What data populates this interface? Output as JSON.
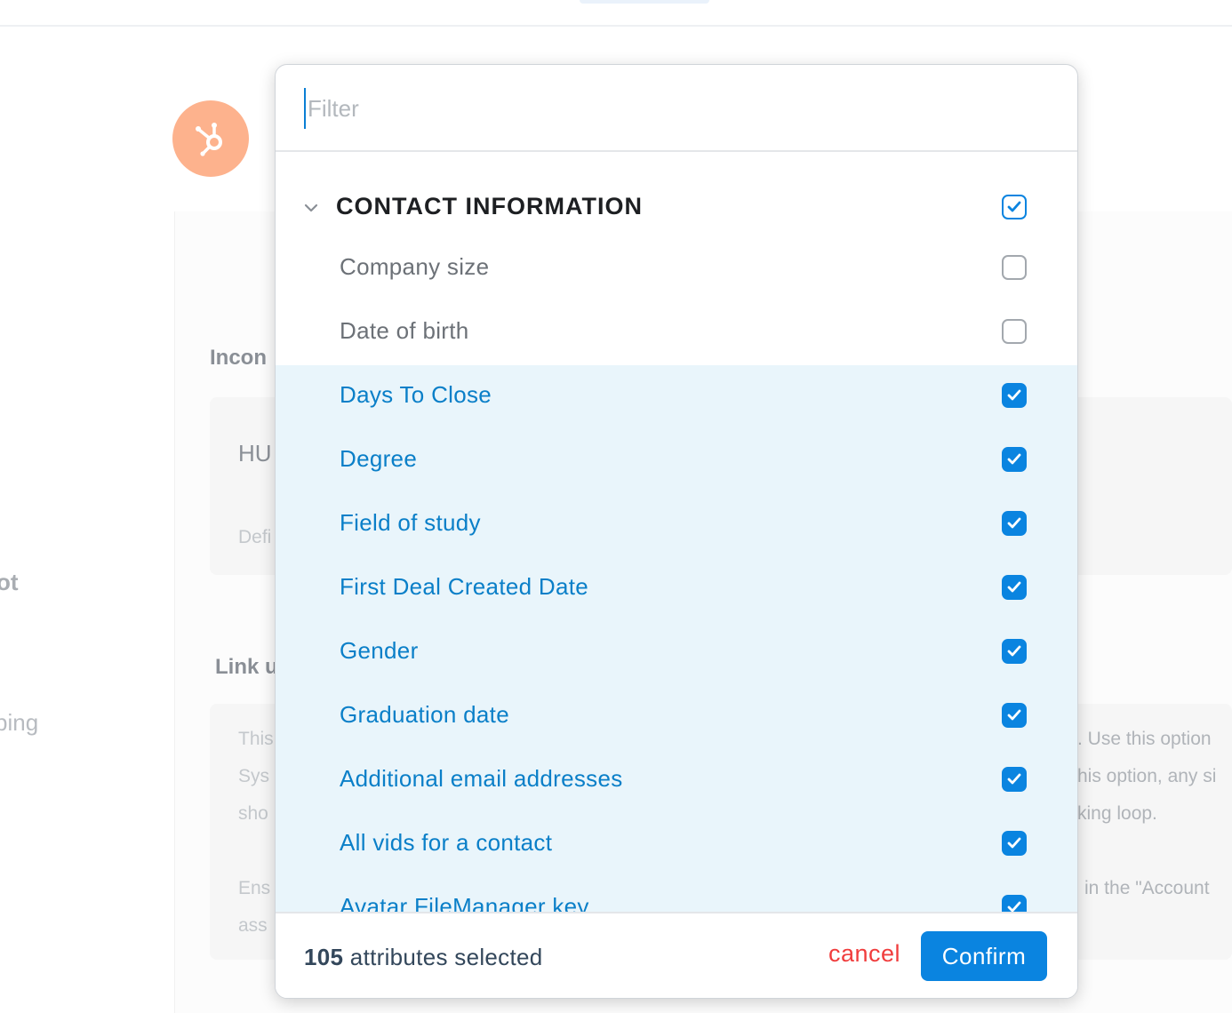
{
  "background": {
    "heading_income": "Incon",
    "box1_title": "HU",
    "box1_sub": "Defi",
    "heading_link": "Link u",
    "left_ot": "ot",
    "left_ping": "ping",
    "box2_line1_left": "This",
    "box2_line2_left": "Sys",
    "box2_line3_left": "sho",
    "box2_line4_left": "Ens",
    "box2_line5_left": "ass",
    "box2_line1_right": ". Use this option",
    "box2_line2_right": "his option, any si",
    "box2_line3_right": "king loop.",
    "box2_line4_right": "in the \"Account"
  },
  "modal": {
    "filter_placeholder": "Filter",
    "filter_value": "",
    "group": {
      "title": "CONTACT INFORMATION",
      "checked": true
    },
    "items": [
      {
        "label": "Company size",
        "checked": false
      },
      {
        "label": "Date of birth",
        "checked": false
      },
      {
        "label": "Days To Close",
        "checked": true
      },
      {
        "label": "Degree",
        "checked": true
      },
      {
        "label": "Field of study",
        "checked": true
      },
      {
        "label": "First Deal Created Date",
        "checked": true
      },
      {
        "label": "Gender",
        "checked": true
      },
      {
        "label": "Graduation date",
        "checked": true
      },
      {
        "label": "Additional email addresses",
        "checked": true
      },
      {
        "label": "All vids for a contact",
        "checked": true
      },
      {
        "label": "Avatar FileManager key",
        "checked": true
      }
    ],
    "footer": {
      "count": "105",
      "count_suffix": " attributes selected",
      "cancel_label": "cancel",
      "confirm_label": "Confirm"
    }
  },
  "colors": {
    "accent": "#0a84e0",
    "selected_row_bg": "#e9f5fb",
    "cancel": "#f03d3d",
    "logo_bg": "#fdb28d"
  }
}
